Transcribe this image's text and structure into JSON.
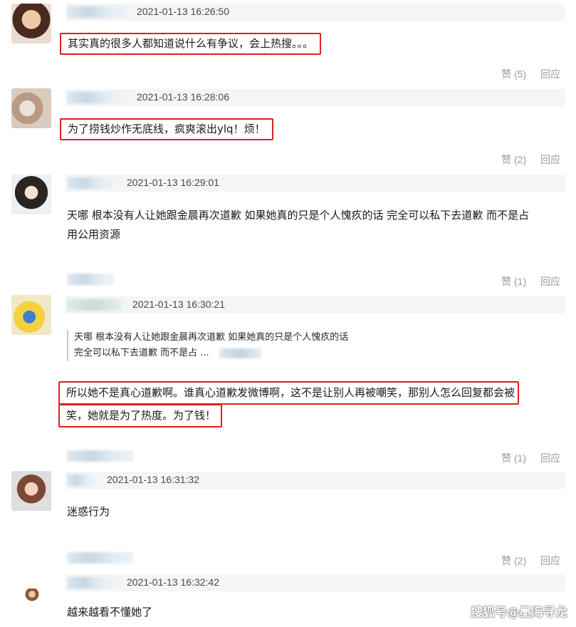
{
  "comments": [
    {
      "time": "2021-01-13 16:26:50",
      "text": "其实真的很多人都知道说什么有争议，会上热搜。。。",
      "likes": "赞 (5)",
      "reply": "回应"
    },
    {
      "time": "2021-01-13 16:28:06",
      "text": "为了捞钱炒作无底线，疯爽滚出ylq！烦！",
      "likes": "赞 (2)",
      "reply": "回应"
    },
    {
      "time": "2021-01-13 16:29:01",
      "text_line1": "天哪 根本没有人让她跟金晨再次道歉 如果她真的只是个人愧疚的话 完全可以私下去道歉 而不是占",
      "text_line2": "用公用资源",
      "likes": "赞 (1)",
      "reply": "回应"
    },
    {
      "time": "2021-01-13 16:30:21",
      "quote_line1": "天哪 根本没有人让她跟金晨再次道歉 如果她真的只是个人愧疚的话",
      "quote_line2": "完全可以私下去道歉 而不是占 ...",
      "text_line1": "所以她不是真心道歉啊。谁真心道歉发微博啊，这不是让别人再被嘲笑，那别人怎么回复都会被",
      "text_line2": "笑，她就是为了热度。为了钱！",
      "likes": "赞 (1)",
      "reply": "回应"
    },
    {
      "time": "2021-01-13 16:31:32",
      "text": "迷惑行为",
      "likes": "赞 (2)",
      "reply": "回应"
    },
    {
      "time": "2021-01-13 16:32:42",
      "text": "越来越看不懂她了"
    }
  ],
  "watermark": "搜狐号@墨海寻龙",
  "colors": {
    "highlight": "#e02020",
    "bar": "#f3f5f7",
    "action": "#9a9a9a"
  },
  "icons": [
    "like",
    "reply"
  ]
}
